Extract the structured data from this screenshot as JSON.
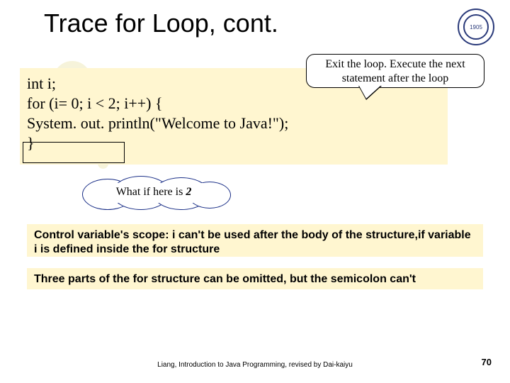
{
  "title": "Trace for Loop, cont.",
  "logo_year": "1905",
  "callout": {
    "line1": "Exit the loop. Execute the next",
    "line2": "statement after the loop"
  },
  "code": {
    "l1": "int i;",
    "l2": "for (i= 0; i < 2; i++) {",
    "l3": "  System. out. println(\"Welcome to Java!\");",
    "l4": "}"
  },
  "whatif": {
    "prefix": "What if here is ",
    "num": "2"
  },
  "notes": {
    "n1": "Control variable's scope:  i can't be used after the body of the structure,if variable i is defined inside the for structure",
    "n2": "Three parts of the for structure can be omitted, but the semicolon can't"
  },
  "footer": "Liang, Introduction to Java Programming, revised by Dai-kaiyu",
  "page": "70"
}
